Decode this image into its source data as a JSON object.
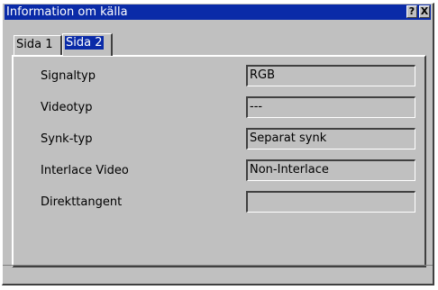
{
  "window": {
    "title": "Information om källa",
    "help_button": "?",
    "close_button": "X"
  },
  "tabs": [
    {
      "label": "Sida 1",
      "active": false
    },
    {
      "label": "Sida 2",
      "active": true
    }
  ],
  "fields": [
    {
      "label": "Signaltyp",
      "value": "RGB"
    },
    {
      "label": "Videotyp",
      "value": "---"
    },
    {
      "label": "Synk-typ",
      "value": "Separat synk"
    },
    {
      "label": "Interlace Video",
      "value": "Non-Interlace"
    },
    {
      "label": "Direkttangent",
      "value": ""
    }
  ],
  "colors": {
    "titlebar": "#0a2ba8",
    "face": "#c0c0c0"
  }
}
